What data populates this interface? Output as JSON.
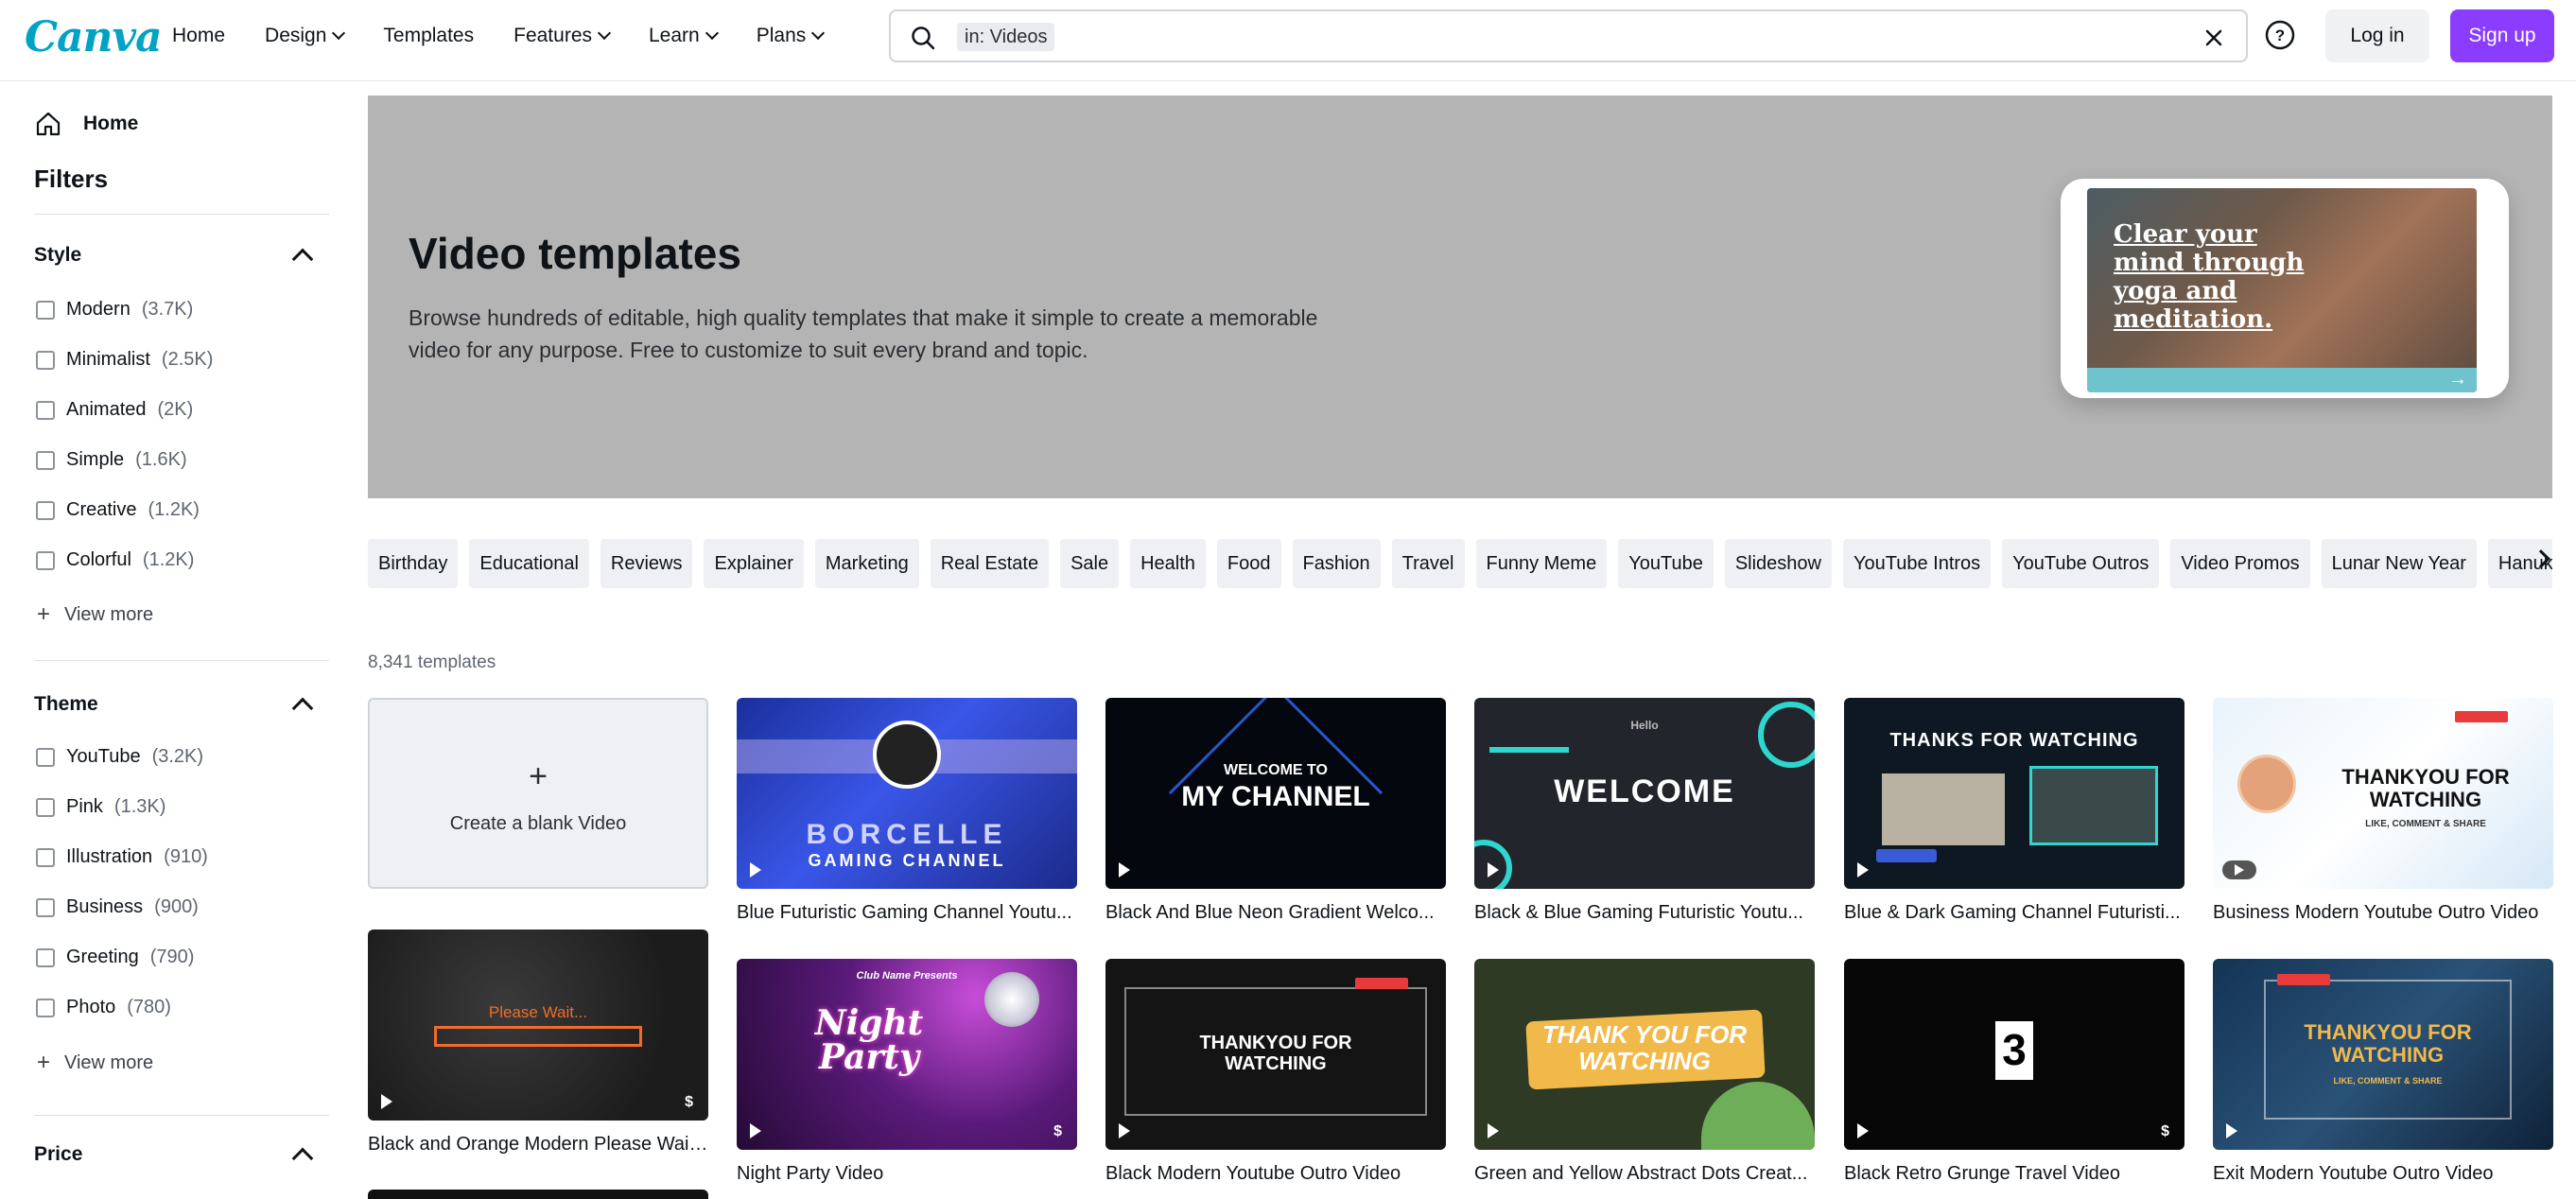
{
  "header": {
    "logo": "Canva",
    "nav": [
      {
        "label": "Home",
        "dropdown": false
      },
      {
        "label": "Design",
        "dropdown": true
      },
      {
        "label": "Templates",
        "dropdown": false
      },
      {
        "label": "Features",
        "dropdown": true
      },
      {
        "label": "Learn",
        "dropdown": true
      },
      {
        "label": "Plans",
        "dropdown": true
      }
    ],
    "search": {
      "chip": "in: Videos",
      "value": ""
    },
    "login_label": "Log in",
    "signup_label": "Sign up",
    "accent_color": "#8b3dff"
  },
  "sidebar": {
    "home_label": "Home",
    "filters_title": "Filters",
    "style": {
      "title": "Style",
      "items": [
        {
          "label": "Modern",
          "count": "(3.7K)"
        },
        {
          "label": "Minimalist",
          "count": "(2.5K)"
        },
        {
          "label": "Animated",
          "count": "(2K)"
        },
        {
          "label": "Simple",
          "count": "(1.6K)"
        },
        {
          "label": "Creative",
          "count": "(1.2K)"
        },
        {
          "label": "Colorful",
          "count": "(1.2K)"
        }
      ],
      "view_more": "View more"
    },
    "theme": {
      "title": "Theme",
      "items": [
        {
          "label": "YouTube",
          "count": "(3.2K)"
        },
        {
          "label": "Pink",
          "count": "(1.3K)"
        },
        {
          "label": "Illustration",
          "count": "(910)"
        },
        {
          "label": "Business",
          "count": "(900)"
        },
        {
          "label": "Greeting",
          "count": "(790)"
        },
        {
          "label": "Photo",
          "count": "(780)"
        }
      ],
      "view_more": "View more"
    },
    "price": {
      "title": "Price"
    }
  },
  "hero": {
    "title": "Video templates",
    "description": "Browse hundreds of editable, high quality templates that make it simple to create a memorable video for any purpose. Free to customize to suit every brand and topic.",
    "preview_text": "Clear your mind through yoga and meditation."
  },
  "chips": [
    "Birthday",
    "Educational",
    "Reviews",
    "Explainer",
    "Marketing",
    "Real Estate",
    "Sale",
    "Health",
    "Food",
    "Fashion",
    "Travel",
    "Funny Meme",
    "YouTube",
    "Slideshow",
    "YouTube Intros",
    "YouTube Outros",
    "Video Promos",
    "Lunar New Year",
    "Hanukkah"
  ],
  "results": {
    "count_label": "8,341 templates",
    "blank_label": "Create a blank Video",
    "row1": [
      {
        "title": "Blue Futuristic Gaming Channel Youtu...",
        "thumb_text": "BORCELLE",
        "thumb_sub": "GAMING CHANNEL"
      },
      {
        "title": "Black And Blue Neon Gradient Welco...",
        "thumb_text": "MY CHANNEL",
        "thumb_sub": "WELCOME TO"
      },
      {
        "title": "Black & Blue Gaming Futuristic Youtu...",
        "thumb_text": "WELCOME",
        "thumb_sub": "Hello"
      },
      {
        "title": "Blue & Dark Gaming Channel Futuristi...",
        "thumb_text": "THANKS FOR WATCHING",
        "thumb_sub": ""
      },
      {
        "title": "Business Modern Youtube Outro Video",
        "thumb_text": "THANKYOU FOR WATCHING",
        "thumb_sub": "LIKE, COMMENT & SHARE"
      }
    ],
    "col1_card": {
      "title": "Black and Orange Modern Please Wait...",
      "thumb_text": "Please Wait..."
    },
    "row2": [
      {
        "title": "Night Party Video",
        "thumb_text": "Night Party",
        "thumb_sub": "Club Name Presents"
      },
      {
        "title": "Black Modern Youtube Outro Video",
        "thumb_text": "THANKYOU FOR WATCHING",
        "thumb_sub": ""
      },
      {
        "title": "Green and Yellow Abstract Dots Creat...",
        "thumb_text": "THANK YOU FOR WATCHING",
        "thumb_sub": ""
      },
      {
        "title": "Black Retro Grunge Travel Video",
        "thumb_text": "3",
        "thumb_sub": ""
      },
      {
        "title": "Exit Modern Youtube Outro Video",
        "thumb_text": "THANKYOU FOR WATCHING",
        "thumb_sub": "LIKE, COMMENT & SHARE"
      }
    ]
  }
}
